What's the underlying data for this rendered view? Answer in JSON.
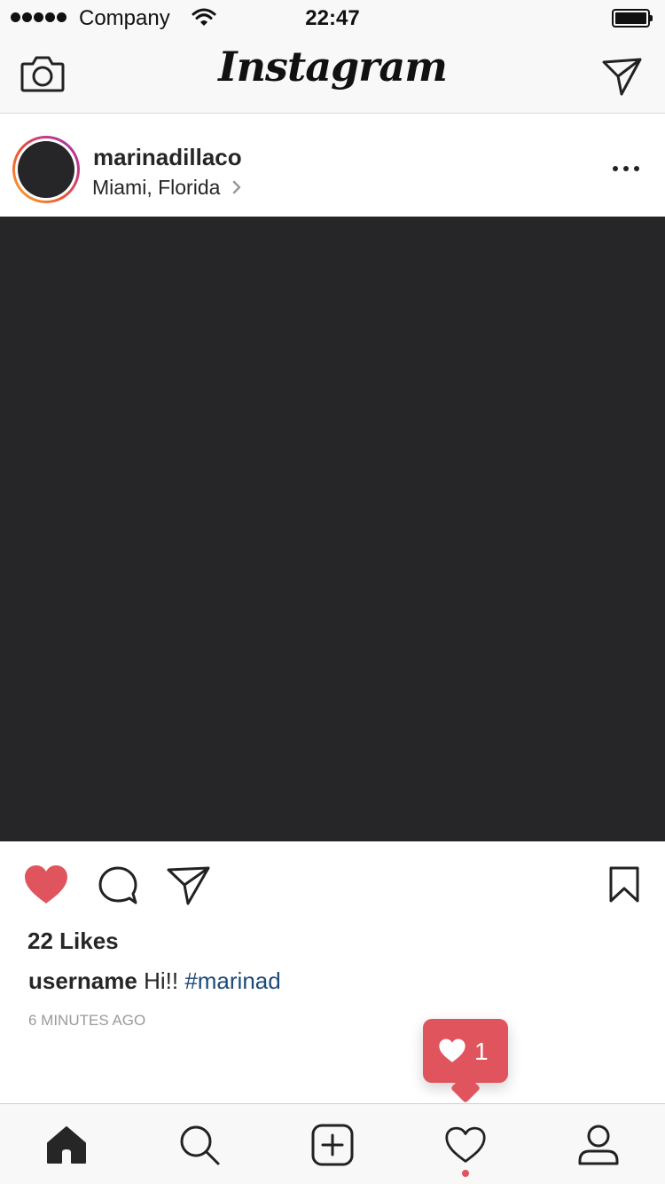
{
  "status_bar": {
    "carrier": "Company",
    "time": "22:47"
  },
  "nav": {
    "title": "Instagram",
    "camera_icon": "camera-icon",
    "direct_icon": "paper-plane-icon"
  },
  "post": {
    "username": "marinadillaco",
    "location": "Miami, Florida",
    "likes": "22 Likes",
    "caption_user": "username",
    "caption_text": "Hi!!",
    "caption_tag": "#marinad",
    "timestamp": "6 MINUTES AGO",
    "liked": true
  },
  "notification": {
    "count": "1",
    "icon": "heart-icon"
  },
  "tabs": [
    {
      "name": "home",
      "icon": "home-icon",
      "active": true
    },
    {
      "name": "search",
      "icon": "search-icon",
      "active": false
    },
    {
      "name": "new-post",
      "icon": "add-square-icon",
      "active": false
    },
    {
      "name": "activity",
      "icon": "heart-outline-icon",
      "active": false
    },
    {
      "name": "profile",
      "icon": "person-icon",
      "active": false
    }
  ],
  "colors": {
    "like_red": "#e0555d",
    "hashtag_blue": "#1c4a78",
    "photo_bg": "#262629",
    "bar_bg": "#f8f8f8"
  }
}
